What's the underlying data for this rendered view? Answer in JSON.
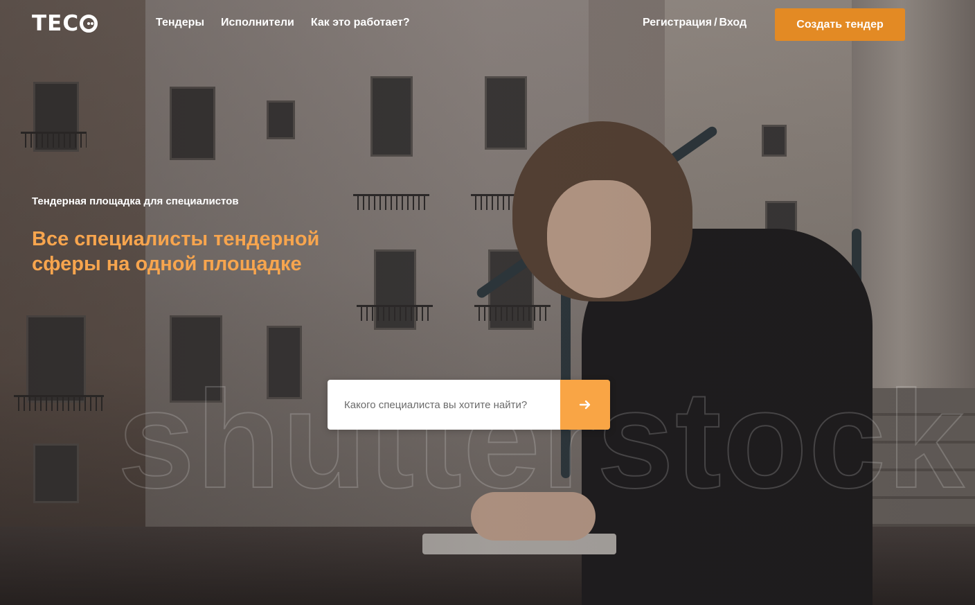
{
  "header": {
    "logo_text": "TEC",
    "nav": [
      {
        "label": "Тендеры"
      },
      {
        "label": "Исполнители"
      },
      {
        "label": "Как это работает?"
      }
    ],
    "auth": {
      "register_label": "Регистрация",
      "separator": "/",
      "login_label": "Вход"
    },
    "cta_label": "Создать тендер"
  },
  "hero": {
    "subtitle": "Тендерная площадка для специалистов",
    "headline": "Все специалисты тендерной сферы на одной площадке",
    "watermark": "shutterstock"
  },
  "search": {
    "placeholder": "Какого специалиста вы хотите найти?",
    "value": "",
    "submit_icon": "arrow-right-icon"
  },
  "colors": {
    "accent": "#e38a24",
    "headline": "#f7a54e",
    "search_button": "#f9a545"
  }
}
